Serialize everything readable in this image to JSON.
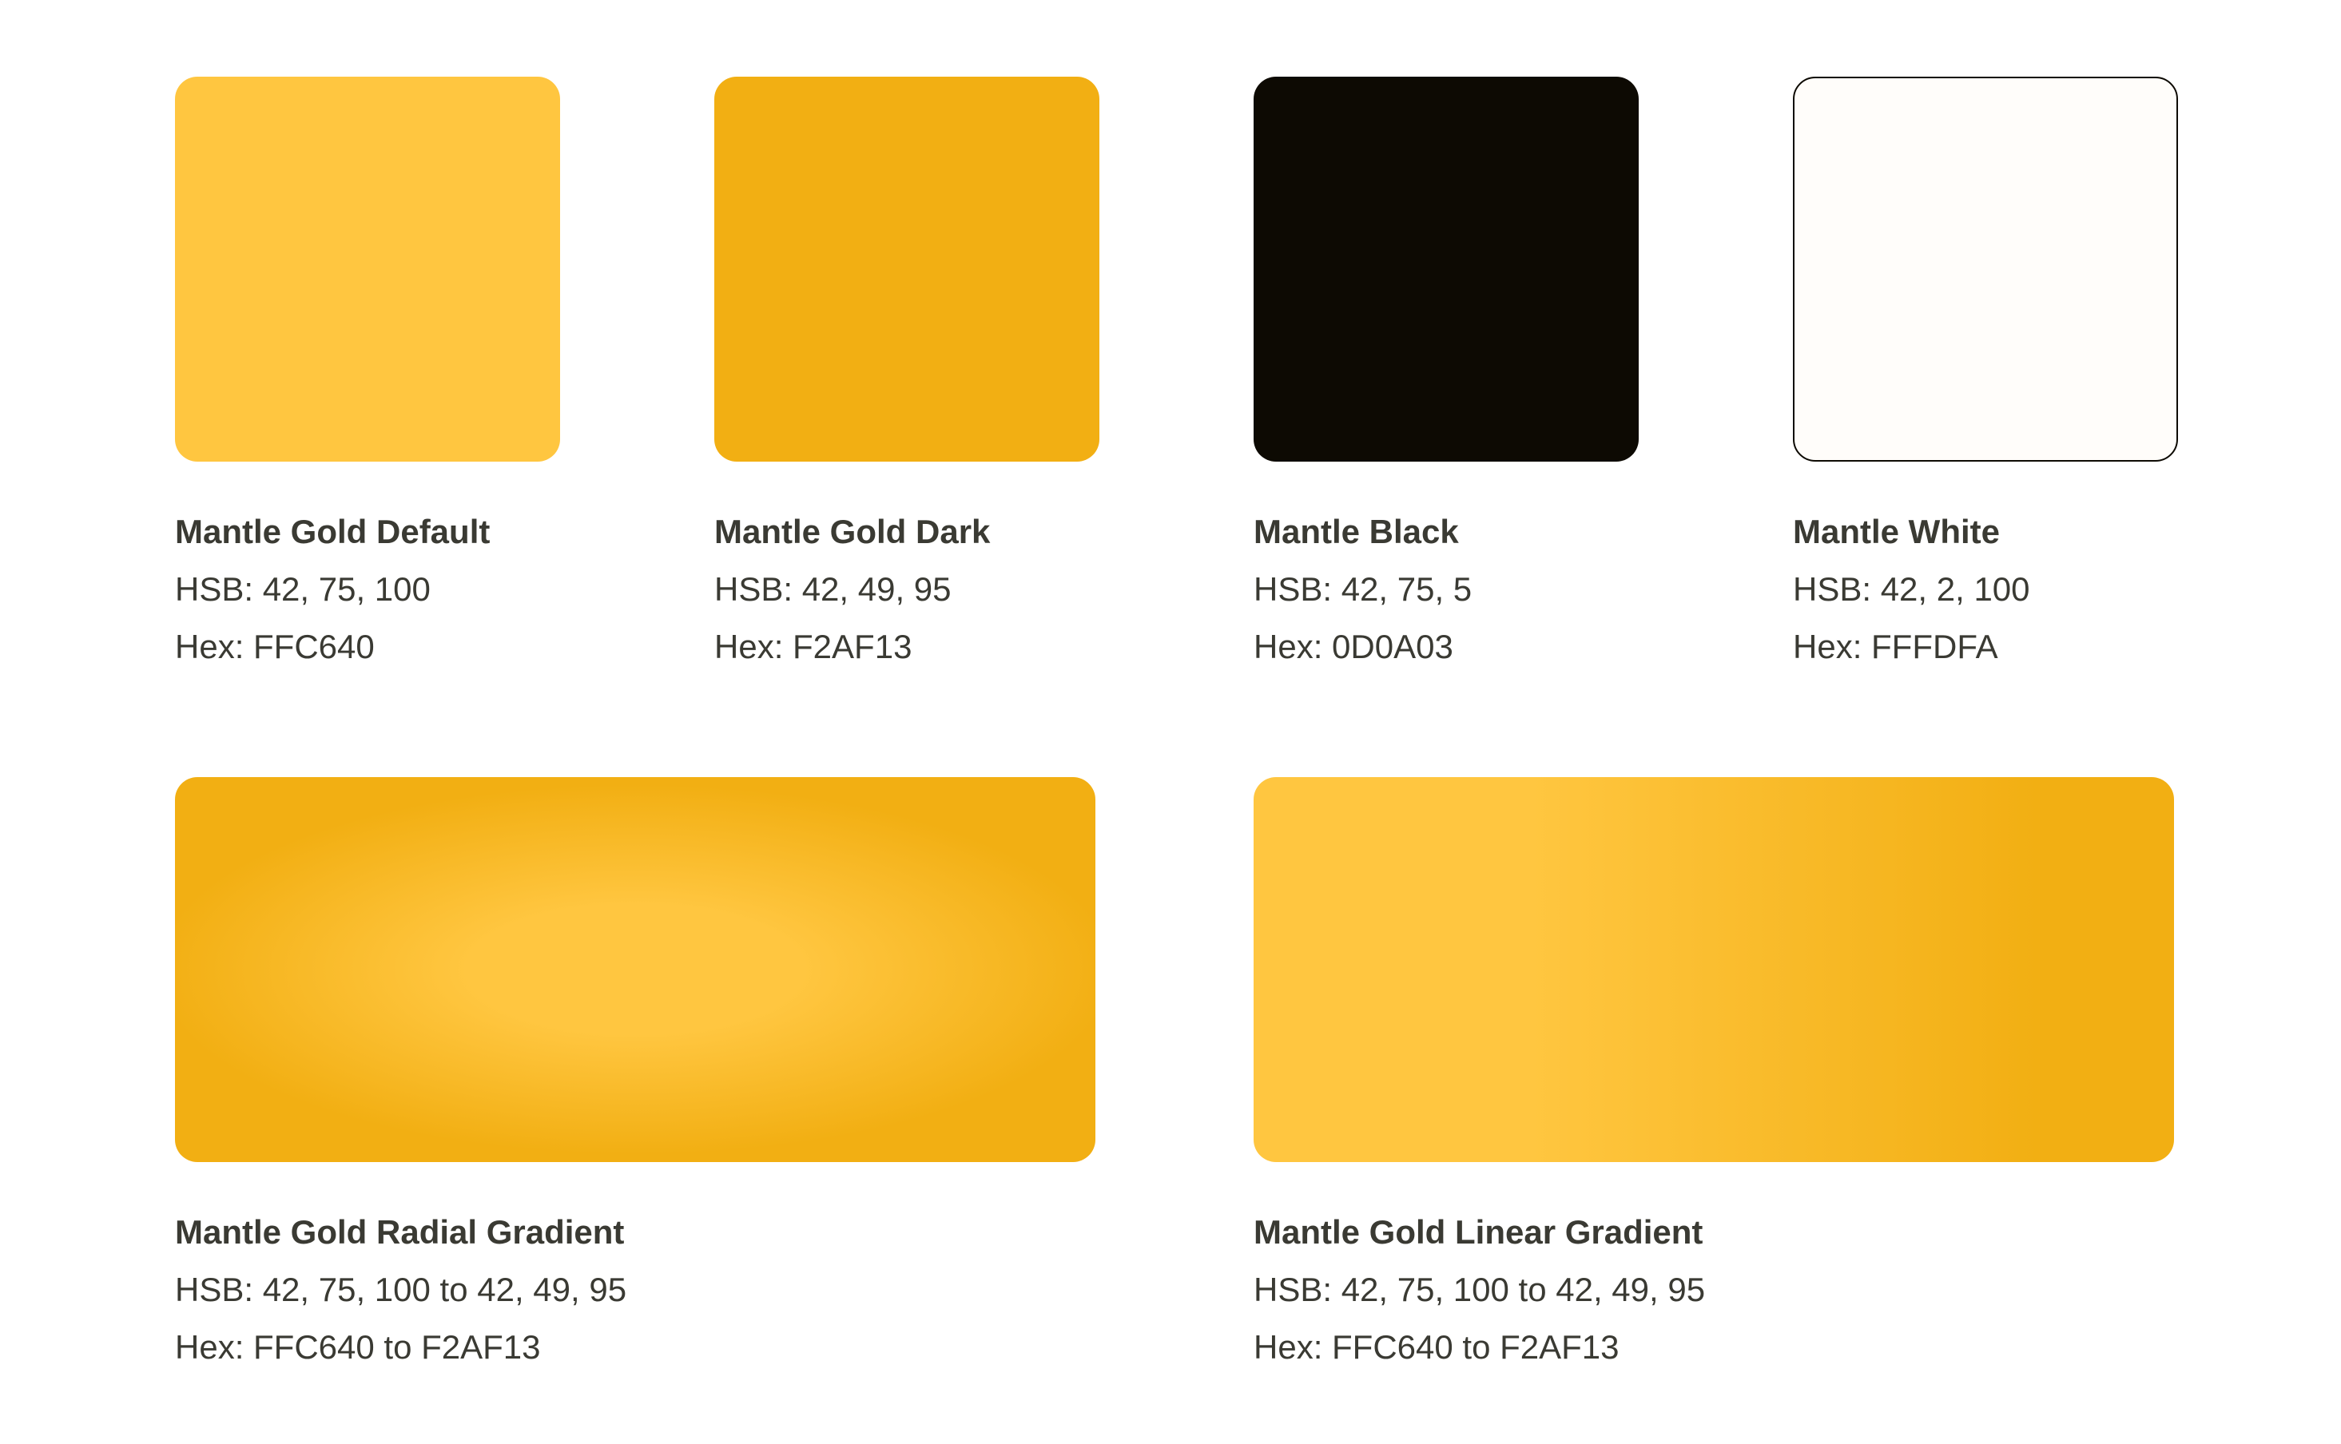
{
  "swatches": [
    {
      "name": "Mantle Gold Default",
      "hsb": "HSB: 42, 75, 100",
      "hex": "Hex: FFC640",
      "color": "#FFC640"
    },
    {
      "name": "Mantle Gold Dark",
      "hsb": "HSB: 42, 49, 95",
      "hex": "Hex: F2AF13",
      "color": "#F2AF13"
    },
    {
      "name": "Mantle Black",
      "hsb": "HSB: 42, 75, 5",
      "hex": "Hex: 0D0A03",
      "color": "#0D0A03"
    },
    {
      "name": "Mantle White",
      "hsb": "HSB: 42, 2, 100",
      "hex": "Hex: FFFDFA",
      "color": "#FFFDFA"
    }
  ],
  "gradients": [
    {
      "name": "Mantle Gold Radial Gradient",
      "hsb": "HSB: 42, 75, 100 to 42, 49, 95",
      "hex": "Hex: FFC640 to F2AF13",
      "from": "#FFC640",
      "to": "#F2AF13"
    },
    {
      "name": "Mantle Gold Linear Gradient",
      "hsb": "HSB: 42, 75, 100 to 42, 49, 95",
      "hex": "Hex: FFC640 to F2AF13",
      "from": "#FFC640",
      "to": "#F2AF13"
    }
  ]
}
